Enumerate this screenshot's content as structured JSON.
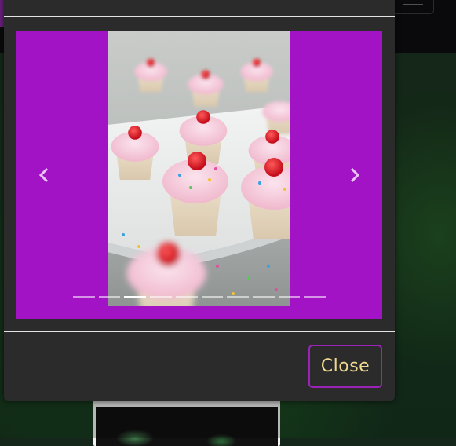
{
  "background": {
    "navbar_toggler_icon": "hamburger-icon",
    "card_image_alt": "cupcake-thumbnail"
  },
  "modal": {
    "carousel": {
      "slide_image": "pink-frosted-cupcakes-photo",
      "prev_icon": "chevron-left-icon",
      "next_icon": "chevron-right-icon",
      "indicator_count": 10,
      "active_index": 2,
      "background_color": "#a213c6"
    },
    "footer": {
      "close_label": "Close"
    }
  },
  "colors": {
    "accent": "#9b23b8",
    "close_text": "#f0d890",
    "modal_bg": "#2b2b2b"
  }
}
